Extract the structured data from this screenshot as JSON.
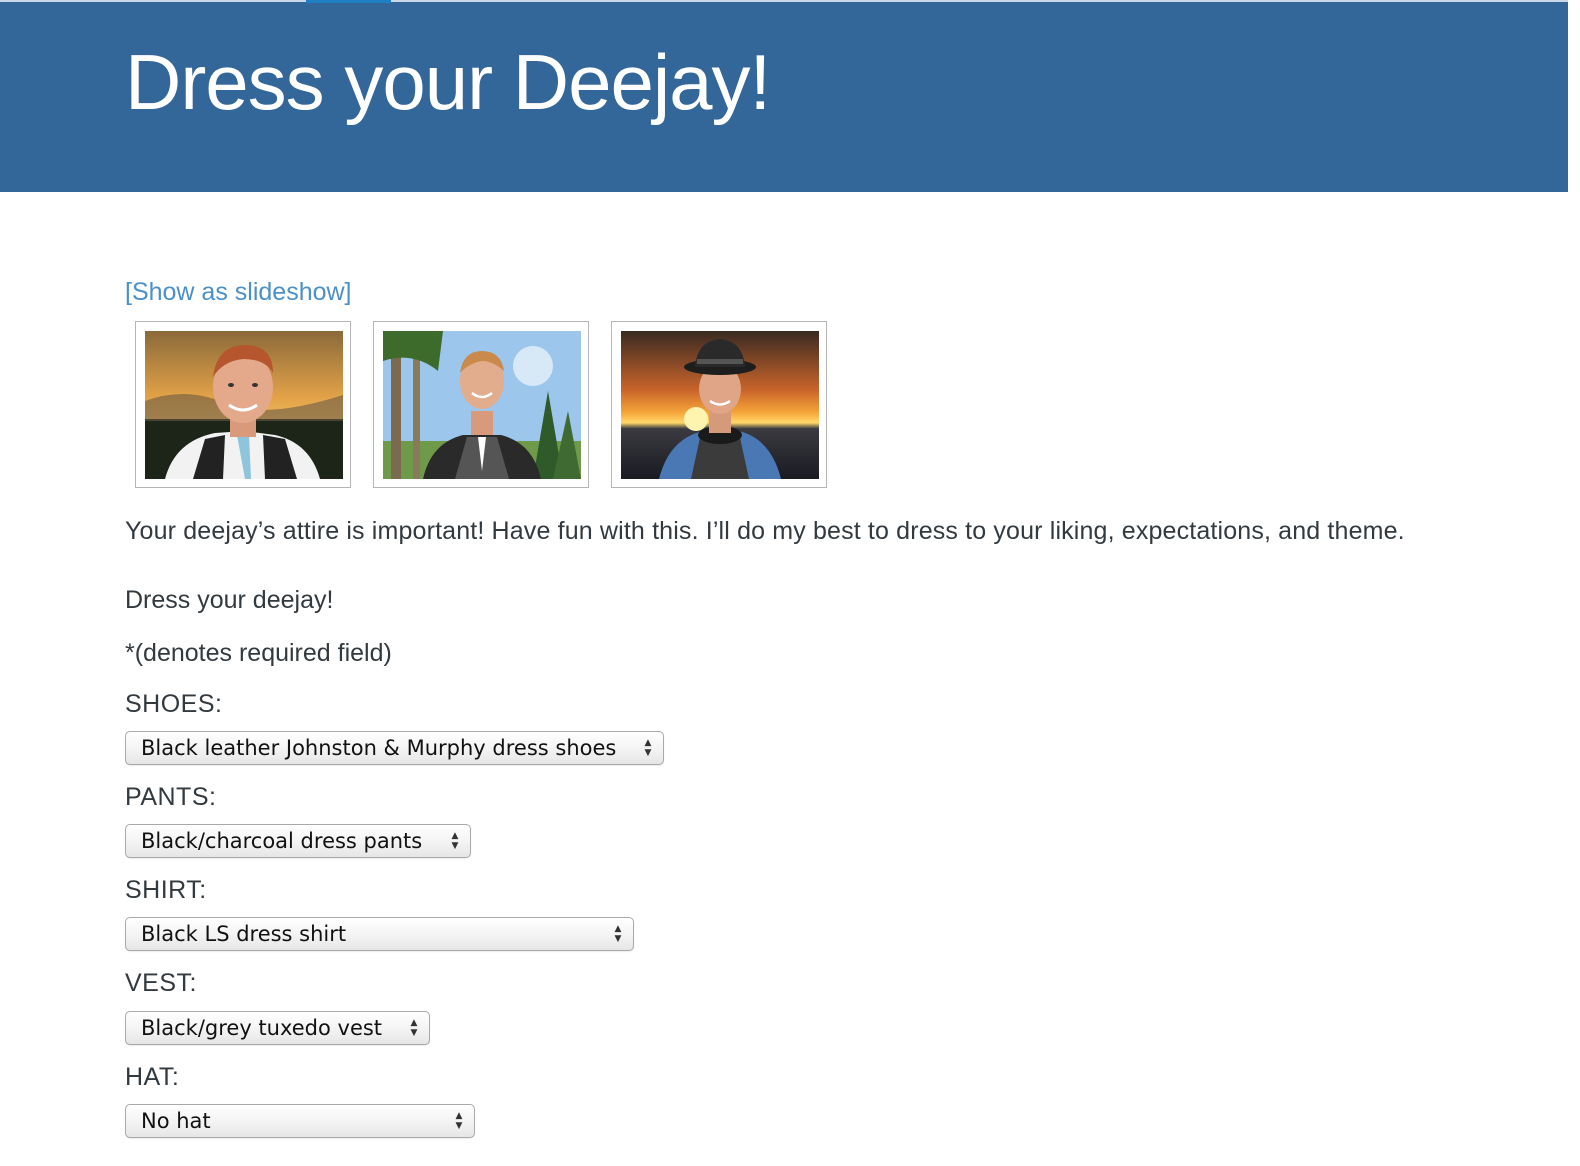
{
  "header": {
    "title": "Dress your Deejay!",
    "background_color": "#336699"
  },
  "gallery": {
    "slideshow_link": "[Show as slideshow]",
    "photos": [
      {
        "subject": "deejay portrait at sunset, white shirt, light blue tie, dark vest"
      },
      {
        "subject": "deejay under palm trees, black shirt, white tie, grey vest"
      },
      {
        "subject": "deejay at ocean sunset, blue shirt, fedora hat, headphones"
      }
    ]
  },
  "content": {
    "intro": "Your deejay’s attire is important! Have fun with this. I’ll do my best to dress to your liking, expectations, and theme.",
    "form_heading": "Dress your deejay!",
    "required_note": "*(denotes required field)"
  },
  "form": {
    "fields": [
      {
        "label": "SHOES:",
        "selected": "Black leather Johnston & Murphy dress shoes"
      },
      {
        "label": "PANTS:",
        "selected": "Black/charcoal dress pants"
      },
      {
        "label": "SHIRT:",
        "selected": "Black LS dress shirt"
      },
      {
        "label": "VEST:",
        "selected": "Black/grey tuxedo vest"
      },
      {
        "label": "HAT:",
        "selected": "No hat"
      }
    ]
  },
  "colors": {
    "link": "#4a90c9",
    "text": "#333a3f"
  }
}
